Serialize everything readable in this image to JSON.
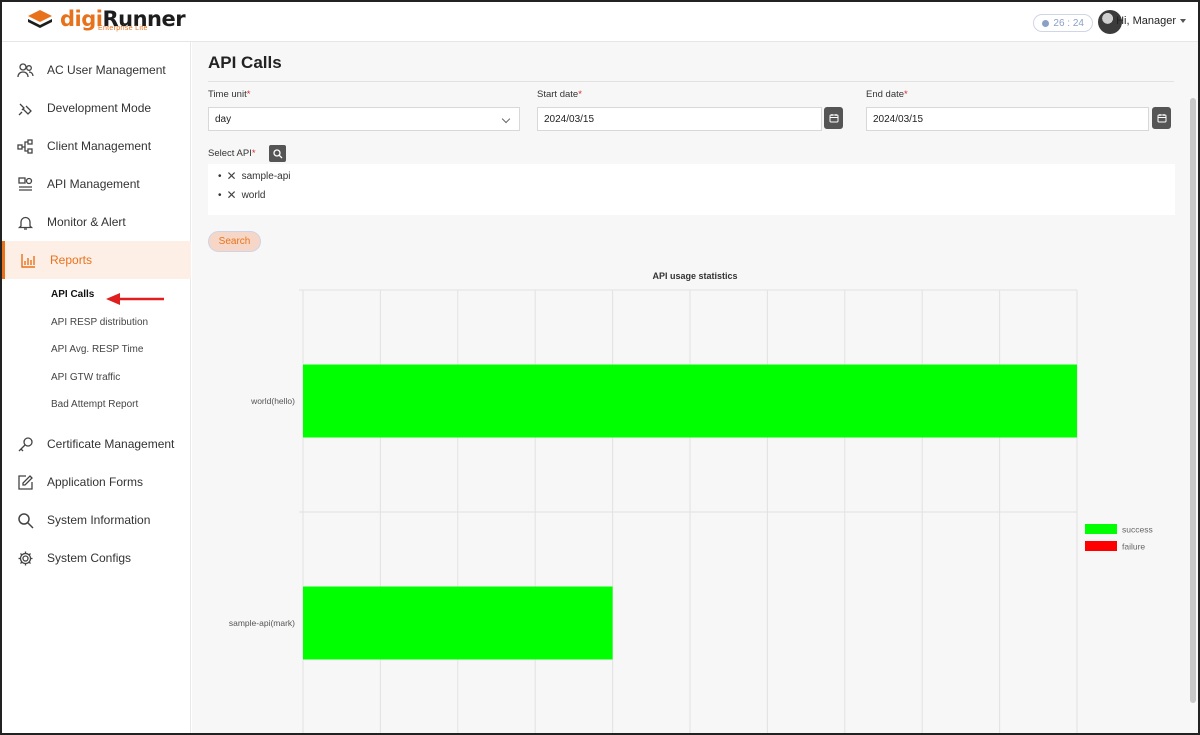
{
  "brand": {
    "name_part1": "digi",
    "name_part2": "Runner",
    "subtitle": "Enterprise Lite"
  },
  "header": {
    "timer": "26 : 24",
    "user_greeting": "Hi, Manager"
  },
  "sidebar": {
    "items": [
      {
        "label": "AC User Management",
        "icon": "users-icon"
      },
      {
        "label": "Development Mode",
        "icon": "code-icon"
      },
      {
        "label": "Client Management",
        "icon": "client-tree-icon"
      },
      {
        "label": "API Management",
        "icon": "api-icon"
      },
      {
        "label": "Monitor & Alert",
        "icon": "bell-icon"
      },
      {
        "label": "Reports",
        "icon": "bar-chart-icon",
        "active": true
      },
      {
        "label": "Certificate Management",
        "icon": "key-icon"
      },
      {
        "label": "Application Forms",
        "icon": "edit-icon"
      },
      {
        "label": "System Information",
        "icon": "search-icon"
      },
      {
        "label": "System Configs",
        "icon": "gear-icon"
      }
    ],
    "reports_sub": [
      {
        "label": "API Calls",
        "active": true
      },
      {
        "label": "API RESP distribution"
      },
      {
        "label": "API Avg. RESP Time"
      },
      {
        "label": "API GTW traffic"
      },
      {
        "label": "Bad Attempt Report"
      }
    ]
  },
  "main": {
    "title": "API Calls",
    "time_unit": {
      "label": "Time unit",
      "value": "day"
    },
    "start_date": {
      "label": "Start date",
      "value": "2024/03/15"
    },
    "end_date": {
      "label": "End date",
      "value": "2024/03/15"
    },
    "select_api": {
      "label": "Select API",
      "selected": [
        "sample-api",
        "world"
      ]
    },
    "search_button": "Search",
    "required_mark": "*"
  },
  "colors": {
    "accent": "#e8721c",
    "success": "#00ff00",
    "failure": "#ff0000"
  },
  "chart_data": {
    "type": "bar",
    "orientation": "horizontal",
    "title": "API usage statistics",
    "categories": [
      "world(hello)",
      "sample-api(mark)"
    ],
    "series": [
      {
        "name": "success",
        "values": [
          5,
          2
        ],
        "color": "#00ff00"
      },
      {
        "name": "failure",
        "values": [
          0,
          0
        ],
        "color": "#ff0000"
      }
    ],
    "xlim": [
      0,
      5
    ],
    "xticks": [
      "0",
      "0.5",
      "1.0",
      "1.5",
      "2.0",
      "2.5",
      "3.0",
      "3.5",
      "4.0",
      "4.5",
      "5.0"
    ],
    "grid": true,
    "legend": "right"
  }
}
